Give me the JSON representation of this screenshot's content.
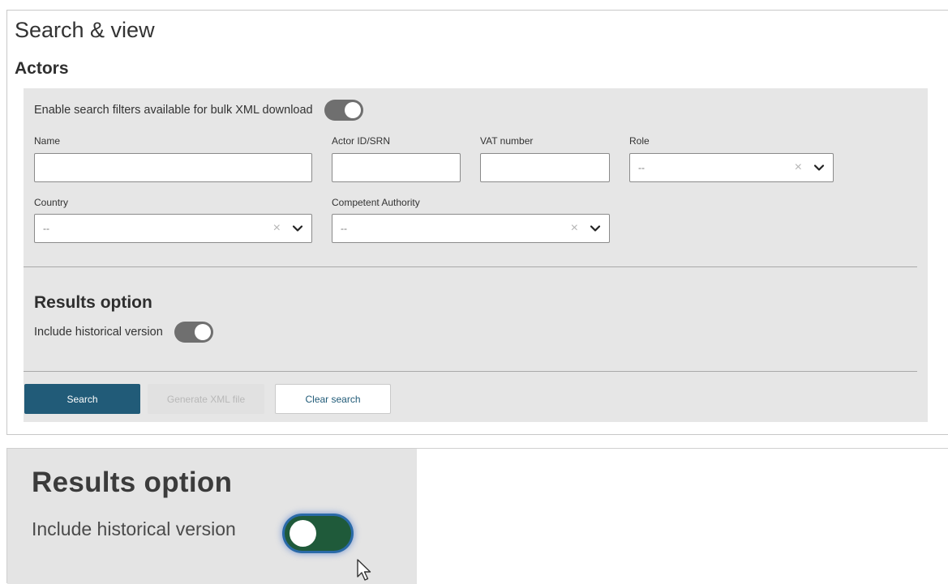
{
  "page": {
    "title": "Search & view",
    "section": "Actors"
  },
  "filters": {
    "bulk_label": "Enable search filters available for bulk XML download",
    "bulk_toggle_on": true,
    "name": {
      "label": "Name",
      "value": ""
    },
    "actor_id": {
      "label": "Actor ID/SRN",
      "value": ""
    },
    "vat": {
      "label": "VAT number",
      "value": ""
    },
    "role": {
      "label": "Role",
      "value": "--"
    },
    "country": {
      "label": "Country",
      "value": "--"
    },
    "authority": {
      "label": "Competent Authority",
      "value": "--"
    }
  },
  "results": {
    "title": "Results option",
    "historical_label": "Include historical version",
    "historical_toggle_on": true
  },
  "buttons": {
    "search": "Search",
    "generate": "Generate XML file",
    "clear": "Clear search"
  },
  "zoom": {
    "title": "Results option",
    "historical_label": "Include historical version",
    "toggle_on": false
  },
  "colors": {
    "primary": "#215b78",
    "toggle_on": "#6f6f6f",
    "zoom_toggle": "#1f5a3a",
    "focus_ring": "#2a6aa8"
  },
  "icons": {
    "clear": "close-icon",
    "dropdown": "chevron-down-icon",
    "pointer": "mouse-cursor-icon"
  }
}
